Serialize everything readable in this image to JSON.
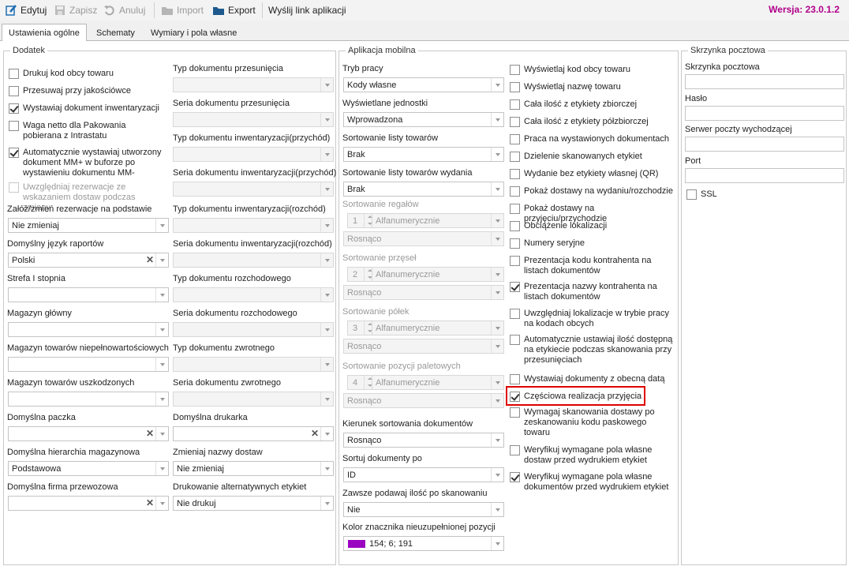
{
  "toolbar": {
    "edit": "Edytuj",
    "save": "Zapisz",
    "cancel": "Anuluj",
    "import": "Import",
    "export": "Export",
    "send_link": "Wyślij link aplikacji",
    "version": "Wersja: 23.0.1.2"
  },
  "tabs": [
    "Ustawienia ogólne",
    "Schematy",
    "Wymiary i pola własne"
  ],
  "dodatek": {
    "title": "Dodatek",
    "checkboxes": [
      {
        "label": "Drukuj kod obcy towaru",
        "checked": false,
        "enabled": true
      },
      {
        "label": "Przesuwaj przy jakościówce",
        "checked": false,
        "enabled": true
      },
      {
        "label": "Wystawiaj dokument inwentaryzacji",
        "checked": true,
        "enabled": true
      },
      {
        "label": "Waga netto dla Pakowania pobierana z Intrastatu",
        "checked": false,
        "enabled": true
      },
      {
        "label": "Automatycznie wystawiaj utworzony dokument MM+ w buforze po wystawieniu dokumentu MM-",
        "checked": true,
        "enabled": true
      },
      {
        "label": "Uwzględniaj rezerwacje ze wskazaniem dostaw podczas zmiany",
        "checked": false,
        "enabled": false
      }
    ],
    "left_fields": [
      {
        "label": "Załóż/zmień rezerwacje na podstawie",
        "value": "Nie zmieniaj",
        "clear": false
      },
      {
        "label": "Domyślny język raportów",
        "value": "Polski",
        "clear": true
      },
      {
        "label": "Strefa I stopnia",
        "value": "",
        "clear": false
      },
      {
        "label": "Magazyn główny",
        "value": "",
        "clear": false
      },
      {
        "label": "Magazyn towarów niepełnowartościowych",
        "value": "",
        "clear": false
      },
      {
        "label": "Magazyn towarów uszkodzonych",
        "value": "",
        "clear": false
      },
      {
        "label": "Domyślna paczka",
        "value": "",
        "clear": true
      },
      {
        "label": "Domyślna hierarchia magazynowa",
        "value": "Podstawowa",
        "clear": false
      },
      {
        "label": "Domyślna firma przewozowa",
        "value": "",
        "clear": true
      }
    ],
    "right_fields": [
      {
        "label": "Typ dokumentu przesunięcia",
        "value": "",
        "clear": false,
        "enabled": false
      },
      {
        "label": "Seria dokumentu przesunięcia",
        "value": "",
        "clear": false,
        "enabled": false
      },
      {
        "label": "Typ dokumentu inwentaryzacji(przychód)",
        "value": "",
        "clear": false,
        "enabled": false
      },
      {
        "label": "Seria dokumentu inwentaryzacji(przychód)",
        "value": "",
        "clear": false,
        "enabled": false
      },
      {
        "label": "Typ dokumentu inwentaryzacji(rozchód)",
        "value": "",
        "clear": false,
        "enabled": false
      },
      {
        "label": "Seria dokumentu inwentaryzacji(rozchód)",
        "value": "",
        "clear": false,
        "enabled": false
      },
      {
        "label": "Typ dokumentu rozchodowego",
        "value": "",
        "clear": false,
        "enabled": false
      },
      {
        "label": "Seria dokumentu rozchodowego",
        "value": "",
        "clear": false,
        "enabled": false
      },
      {
        "label": "Typ dokumentu zwrotnego",
        "value": "",
        "clear": false,
        "enabled": false
      },
      {
        "label": "Seria dokumentu zwrotnego",
        "value": "",
        "clear": false,
        "enabled": false
      },
      {
        "label": "Domyślna drukarka",
        "value": "",
        "clear": true,
        "enabled": true
      },
      {
        "label": "Zmieniaj nazwy dostaw",
        "value": "Nie zmieniaj",
        "clear": false,
        "enabled": true
      },
      {
        "label": "Drukowanie alternatywnych etykiet",
        "value": "Nie drukuj",
        "clear": false,
        "enabled": true
      }
    ]
  },
  "mobile": {
    "title": "Aplikacja mobilna",
    "tryb": {
      "label": "Tryb pracy",
      "value": "Kody własne"
    },
    "jednostki": {
      "label": "Wyświetlane jednostki",
      "value": "Wprowadzona"
    },
    "sort_towarow": {
      "label": "Sortowanie listy towarów",
      "value": "Brak"
    },
    "sort_wydania": {
      "label": "Sortowanie listy towarów wydania",
      "value": "Brak"
    },
    "sort_groups": [
      {
        "label": "Sortowanie regałów",
        "num": "1",
        "type": "Alfanumerycznie",
        "order": "Rosnąco"
      },
      {
        "label": "Sortowanie przęseł",
        "num": "2",
        "type": "Alfanumerycznie",
        "order": "Rosnąco"
      },
      {
        "label": "Sortowanie półek",
        "num": "3",
        "type": "Alfanumerycznie",
        "order": "Rosnąco"
      },
      {
        "label": "Sortowanie pozycji paletowych",
        "num": "4",
        "type": "Alfanumerycznie",
        "order": "Rosnąco"
      }
    ],
    "kierunek": {
      "label": "Kierunek sortowania dokumentów",
      "value": "Rosnąco"
    },
    "sortuj_po": {
      "label": "Sortuj dokumenty po",
      "value": "ID"
    },
    "zawsze": {
      "label": "Zawsze podawaj ilość po skanowaniu",
      "value": "Nie"
    },
    "kolor": {
      "label": "Kolor znacznika nieuzupełnionej pozycji",
      "value": "154; 6; 191",
      "swatch": "#9a06bf"
    },
    "checkboxes": [
      {
        "label": "Wyświetlaj kod obcy towaru",
        "checked": false
      },
      {
        "label": "Wyświetlaj nazwę towaru",
        "checked": false
      },
      {
        "label": "Cała ilość z etykiety zbiorczej",
        "checked": false
      },
      {
        "label": "Cała ilość z etykiety półzbiorczej",
        "checked": false
      },
      {
        "label": "Praca na wystawionych dokumentach",
        "checked": false
      },
      {
        "label": "Dzielenie skanowanych etykiet",
        "checked": false
      },
      {
        "label": "Wydanie bez etykiety własnej (QR)",
        "checked": false
      },
      {
        "label": "Pokaż dostawy na wydaniu/rozchodzie",
        "checked": false
      },
      {
        "label": "Pokaż dostawy na przyjęciu/przychodzie",
        "checked": false
      },
      {
        "label": "Obciążenie lokalizacji",
        "checked": false
      },
      {
        "label": "Numery seryjne",
        "checked": false
      },
      {
        "label": "Prezentacja kodu kontrahenta na listach dokumentów",
        "checked": false
      },
      {
        "label": "Prezentacja nazwy kontrahenta na listach dokumentów",
        "checked": true
      },
      {
        "label": "Uwzględniaj lokalizacje w trybie pracy na kodach obcych",
        "checked": false
      },
      {
        "label": "Automatycznie ustawiaj ilość dostępną na etykiecie podczas skanowania przy przesunięciach",
        "checked": false
      },
      {
        "label": "Wystawiaj dokumenty z obecną datą",
        "checked": false
      },
      {
        "label": "Częściowa realizacja przyjęcia",
        "checked": true
      },
      {
        "label": "Wymagaj skanowania dostawy po zeskanowaniu kodu paskowego towaru",
        "checked": false
      },
      {
        "label": "Weryfikuj wymagane pola własne dostaw przed wydrukiem etykiet",
        "checked": false
      },
      {
        "label": "Weryfikuj wymagane pola własne dokumentów przed wydrukiem etykiet",
        "checked": true
      }
    ]
  },
  "mailbox": {
    "title": "Skrzynka pocztowa",
    "fields": [
      {
        "label": "Skrzynka pocztowa",
        "value": ""
      },
      {
        "label": "Hasło",
        "value": ""
      },
      {
        "label": "Serwer poczty wychodzącej",
        "value": ""
      },
      {
        "label": "Port",
        "value": ""
      }
    ],
    "ssl": {
      "label": "SSL",
      "checked": false
    }
  }
}
